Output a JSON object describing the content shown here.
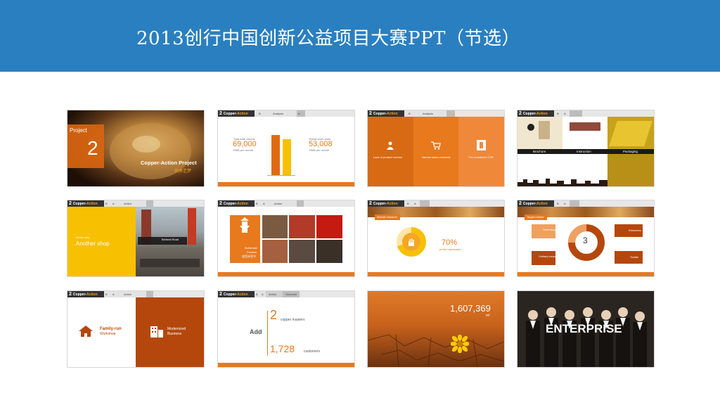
{
  "header": {
    "title": "2013创行中国创新公益项目大赛PPT（节选）"
  },
  "colors": {
    "header": "#2a7fc0",
    "orange": "#e8791d",
    "rust": "#b5470c",
    "yellow": "#f7c000"
  },
  "slides": {
    "s1": {
      "project": "Project",
      "number": "2",
      "name": "Copper-Action Project",
      "name_cn": "铜承艺梦"
    },
    "topbar": {
      "num": "2",
      "brand": "Copper-",
      "brand2": "Action"
    },
    "s2": {
      "sec1": "Analysis",
      "left_label": "Total sale volume",
      "left_value": "69,000",
      "left_unit": "RMB per month",
      "right_label": "Break-even point",
      "right_value": "53,008",
      "right_unit": "RMB per month"
    },
    "s3": {
      "sec1": "Analysis",
      "col1": "Lack of product service",
      "col2": "Narrow sales channels",
      "col3": "The unclaimed CSR"
    },
    "s4": {
      "col1": "Brochure",
      "col2": "Instruction",
      "col3": "Packaging"
    },
    "s5": {
      "sec1": "Action",
      "tag": "Another shop",
      "sub": "Anothe shop",
      "road": "Beiheai Road"
    },
    "s6": {
      "sec1": "Action",
      "text1": "Bohemian",
      "text2": "Festival",
      "text3": "波西米亚节"
    },
    "s7": {
      "tag": "Market research",
      "pct": "70%",
      "pct_label": "prefer handmade"
    },
    "s8": {
      "tag": "Target market",
      "center": "3",
      "left1": "Travel shoppers",
      "left2": "Ordinary households",
      "right1": "Enterprises",
      "right2": "Tourists"
    },
    "s9": {
      "sec1": "Action",
      "left1": "Family-run",
      "left2": "Workshop",
      "right1": "Modernized",
      "right2": "Business"
    },
    "s10": {
      "sec1": "Action",
      "sec2": "Outcome",
      "add": "Add",
      "v1": "2",
      "l1": "copper masters",
      "v2": "1,728",
      "l2": "customers"
    },
    "s11": {
      "value": "1,607,369",
      "unit": "m²"
    },
    "s12": {
      "word": "ENTERPRISE"
    }
  }
}
